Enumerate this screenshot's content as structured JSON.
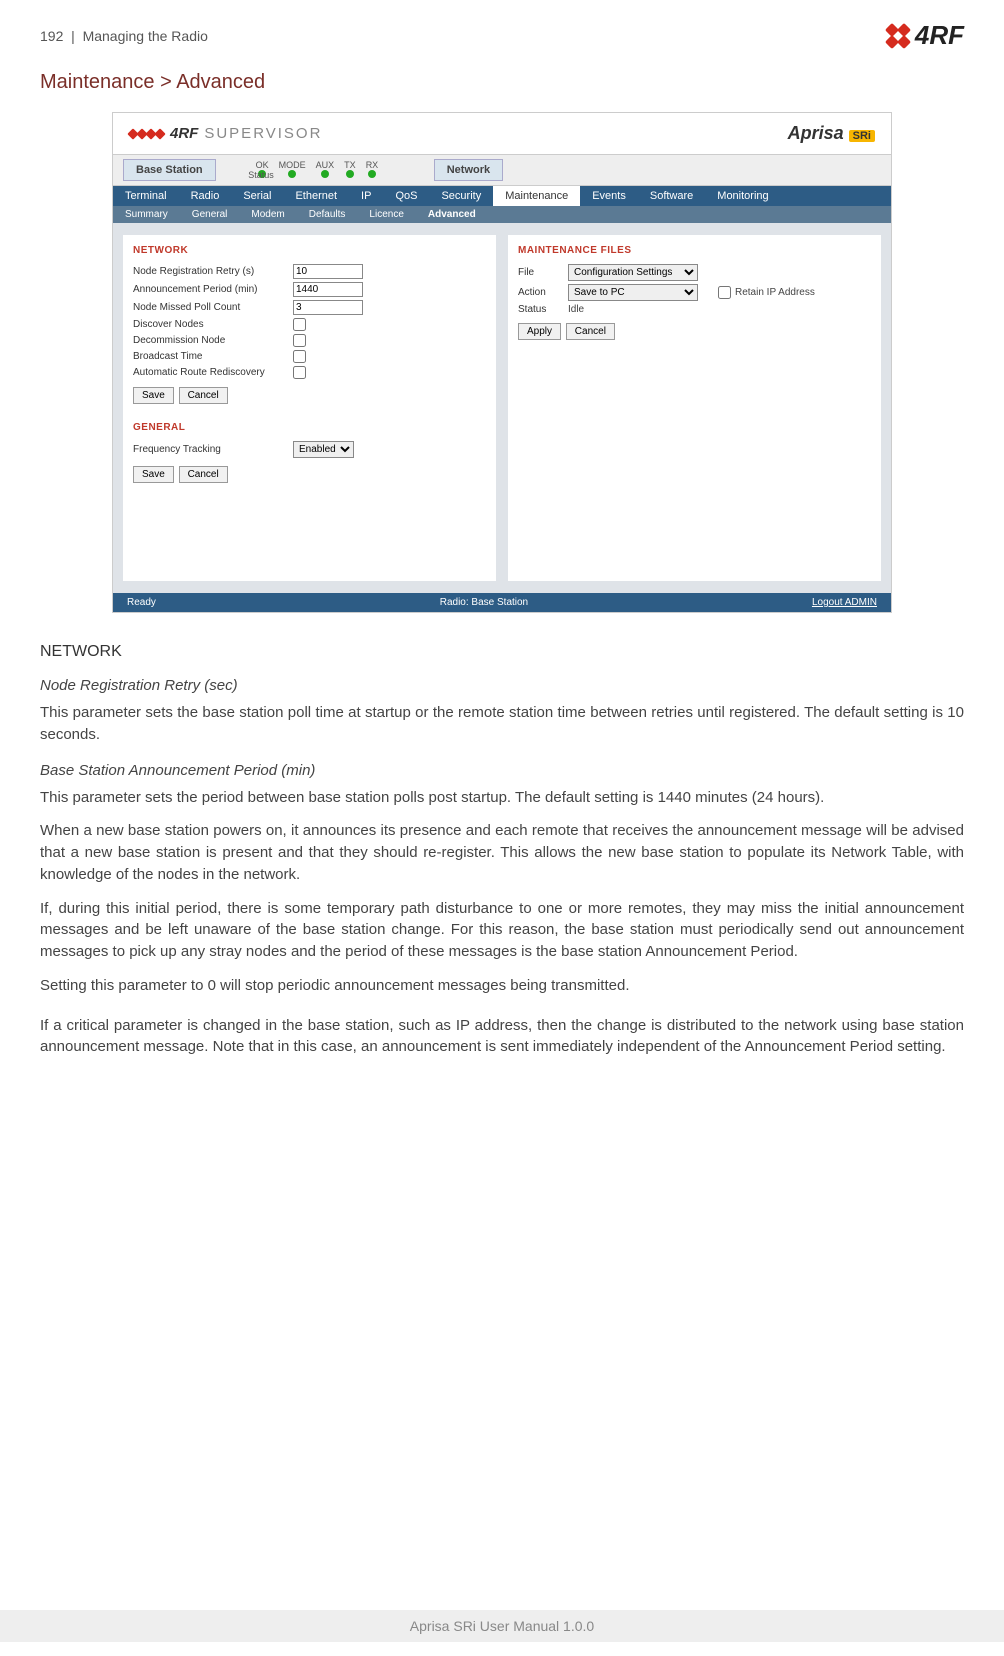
{
  "header": {
    "page_num": "192",
    "crumb": "Managing the Radio",
    "logo_text": "4RF"
  },
  "title": "Maintenance > Advanced",
  "app": {
    "brand": "4RF",
    "brand_sub": "SUPERVISOR",
    "product": "Aprisa",
    "product_badge": "SRi",
    "tab_basestation": "Base Station",
    "tab_network": "Network",
    "leds": {
      "ok": "OK",
      "mode": "MODE",
      "aux": "AUX",
      "tx": "TX",
      "rx": "RX",
      "status": "Status"
    },
    "menu": {
      "terminal": "Terminal",
      "radio": "Radio",
      "serial": "Serial",
      "ethernet": "Ethernet",
      "ip": "IP",
      "qos": "QoS",
      "security": "Security",
      "maintenance": "Maintenance",
      "events": "Events",
      "software": "Software",
      "monitoring": "Monitoring"
    },
    "submenu": {
      "summary": "Summary",
      "general": "General",
      "modem": "Modem",
      "defaults": "Defaults",
      "licence": "Licence",
      "advanced": "Advanced"
    },
    "network_panel": {
      "title": "NETWORK",
      "node_reg_label": "Node Registration Retry (s)",
      "node_reg_val": "10",
      "ann_period_label": "Announcement Period (min)",
      "ann_period_val": "1440",
      "missed_poll_label": "Node Missed Poll Count",
      "missed_poll_val": "3",
      "discover_label": "Discover Nodes",
      "decomm_label": "Decommission Node",
      "broadcast_label": "Broadcast Time",
      "autoroute_label": "Automatic Route Rediscovery",
      "save": "Save",
      "cancel": "Cancel",
      "general_title": "GENERAL",
      "freq_label": "Frequency Tracking",
      "freq_val": "Enabled"
    },
    "maint_panel": {
      "title": "MAINTENANCE FILES",
      "file_label": "File",
      "file_val": "Configuration Settings",
      "action_label": "Action",
      "action_val": "Save to PC",
      "retain_label": "Retain IP Address",
      "status_label": "Status",
      "status_val": "Idle",
      "apply": "Apply",
      "cancel": "Cancel"
    },
    "statusbar": {
      "ready": "Ready",
      "radio": "Radio: Base Station",
      "logout": "Logout ADMIN"
    }
  },
  "doc": {
    "h_network": "NETWORK",
    "h_nrr": "Node Registration Retry (sec)",
    "p_nrr": "This parameter sets the base station poll time at startup or the remote station time between retries until registered. The default setting is 10 seconds.",
    "h_bsap": "Base Station Announcement Period (min)",
    "p_bsap1": "This parameter sets the period between base station polls post startup. The default setting is 1440 minutes (24 hours).",
    "p_bsap2": "When a new base station powers on, it announces its presence and each remote that receives the announcement message will be advised that a new base station is present and that they should re-register. This allows the new base station to populate its Network Table, with knowledge of the nodes in the network.",
    "p_bsap3": "If, during this initial period, there is some temporary path disturbance to one or more remotes, they may miss the initial announcement messages and be left unaware of the base station change. For this reason, the base station must periodically send out announcement messages to pick up any stray nodes and the period of these messages is the base station Announcement Period.",
    "p_bsap4": "Setting this parameter to 0 will stop periodic announcement messages being transmitted.",
    "p_bsap5": "If a critical parameter is changed in the base station, such as IP address, then the change is distributed to the network using base station announcement message. Note that in this case, an announcement is sent immediately independent of the Announcement Period setting."
  },
  "footer": "Aprisa SRi User Manual 1.0.0"
}
